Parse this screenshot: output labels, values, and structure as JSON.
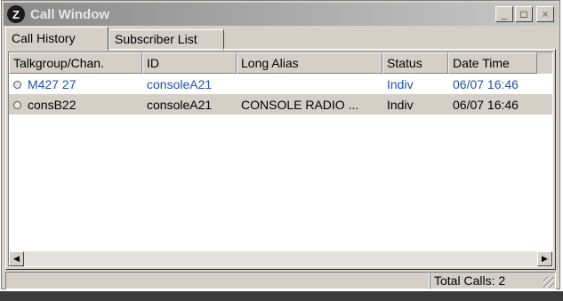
{
  "window": {
    "title": "Call Window",
    "buttons": {
      "minimize": "_",
      "maximize": "□",
      "close": "×"
    }
  },
  "tabs": [
    {
      "label": "Call History",
      "active": true
    },
    {
      "label": "Subscriber List",
      "active": false
    }
  ],
  "table": {
    "columns": [
      "Talkgroup/Chan.",
      "ID",
      "Long Alias",
      "Status",
      "Date Time"
    ],
    "rows": [
      {
        "talkgroup": "M427  27",
        "id": "consoleA21",
        "alias": "",
        "status": "Indiv",
        "datetime": "06/07 16:46"
      },
      {
        "talkgroup": "consB22",
        "id": "consoleA21",
        "alias": "CONSOLE RADIO ...",
        "status": "Indiv",
        "datetime": "06/07 16:46"
      }
    ]
  },
  "scrollbar": {
    "left_arrow": "◀",
    "right_arrow": "▶"
  },
  "statusbar": {
    "left": "",
    "right": "Total Calls: 2"
  },
  "colors": {
    "link_text": "#2050a8",
    "selected_row": "#d4d0c8",
    "chrome": "#d4d0c8"
  },
  "icons": {
    "app": "motorola-logo-icon"
  }
}
